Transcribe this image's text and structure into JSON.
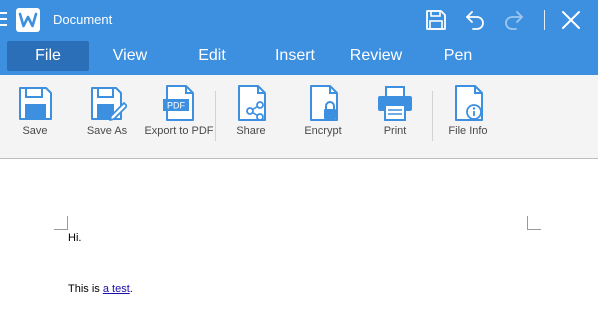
{
  "titlebar": {
    "title": "Document",
    "icons": [
      "menu-icon",
      "app-logo-icon",
      "save-icon",
      "undo-icon",
      "redo-icon",
      "close-icon"
    ]
  },
  "tabs": [
    {
      "label": "File",
      "active": true
    },
    {
      "label": "View",
      "active": false
    },
    {
      "label": "Edit",
      "active": false
    },
    {
      "label": "Insert",
      "active": false
    },
    {
      "label": "Review",
      "active": false
    },
    {
      "label": "Pen",
      "active": false
    }
  ],
  "ribbon": {
    "items": [
      {
        "label": "Save",
        "icon": "save-icon"
      },
      {
        "label": "Save As",
        "icon": "save-as-icon"
      },
      {
        "label": "Export to PDF",
        "icon": "pdf-icon"
      },
      {
        "label": "Share",
        "icon": "share-icon"
      },
      {
        "label": "Encrypt",
        "icon": "lock-icon"
      },
      {
        "label": "Print",
        "icon": "printer-icon"
      },
      {
        "label": "File Info",
        "icon": "info-icon"
      }
    ],
    "pdf_badge": "PDF"
  },
  "document": {
    "line1": "Hi.",
    "line2_prefix": "This is ",
    "line2_link": "a test",
    "line2_suffix": "."
  },
  "colors": {
    "accent": "#3d8fe0",
    "active_tab": "#2a6fb8",
    "ribbon_bg": "#f4f4f4",
    "icon_blue": "#3d8fe0",
    "link": "#1a0dab"
  }
}
